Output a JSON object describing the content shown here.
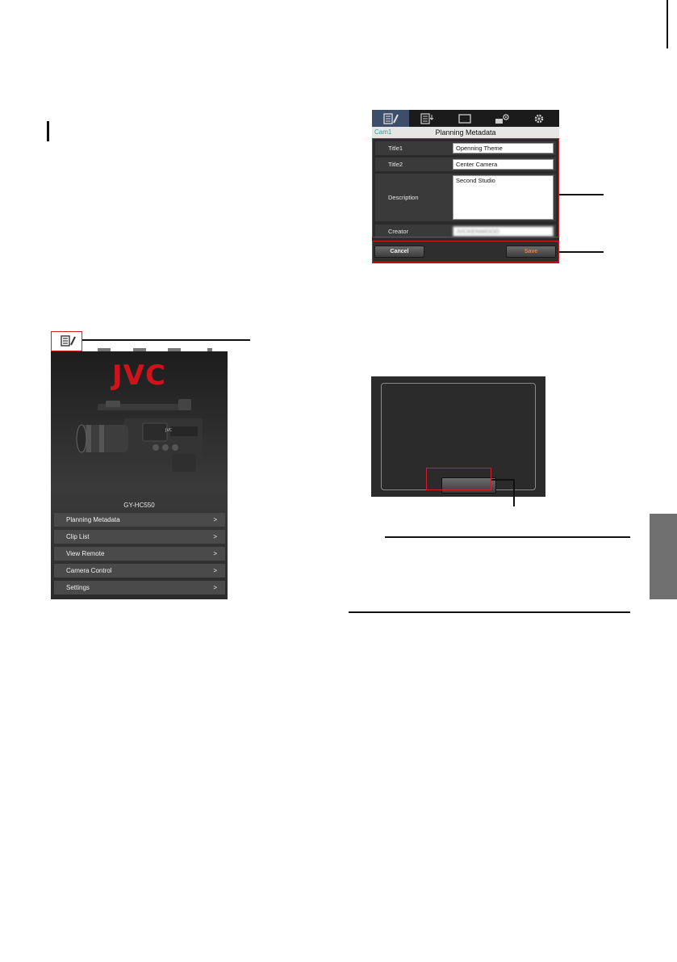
{
  "home_screen": {
    "logo_text": "JVC",
    "model_name": "GY-HC550",
    "tab_icons": [
      "metadata-edit-icon",
      "clip-list-icon",
      "view-remote-icon",
      "camera-control-icon",
      "settings-icon"
    ],
    "menu": [
      {
        "label": "Planning Metadata",
        "chevron": ">"
      },
      {
        "label": "Clip List",
        "chevron": ">"
      },
      {
        "label": "View Remote",
        "chevron": ">"
      },
      {
        "label": "Camera Control",
        "chevron": ">"
      },
      {
        "label": "Settings",
        "chevron": ">"
      }
    ]
  },
  "planning_metadata": {
    "camera_label": "Cam1",
    "title": "Planning Metadata",
    "fields": {
      "title1": {
        "label": "Title1",
        "value": "Openning Theme"
      },
      "title2": {
        "label": "Title2",
        "value": "Center Camera"
      },
      "description": {
        "label": "Description",
        "value": "Second Studio"
      },
      "creator": {
        "label": "Creator",
        "value": "JVCKENWOOD"
      }
    },
    "cancel_label": "Cancel",
    "save_label": "Save"
  },
  "colors": {
    "highlight_red": "#d31f2a",
    "jvc_red": "#d0121b",
    "save_orange": "#ff7b2a",
    "camera_label_teal": "#2aa3a3",
    "side_tab_gray": "#707070"
  }
}
